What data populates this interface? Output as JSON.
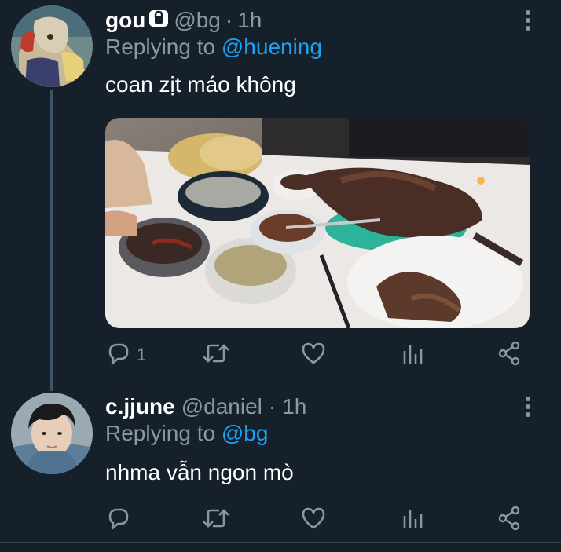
{
  "tweets": [
    {
      "display_name": "gou",
      "handle": "@bg",
      "separator": "·",
      "time": "1h",
      "replying_prefix": "Replying to",
      "replying_to": "@huening",
      "text": "coan zịt máo không",
      "protected": true,
      "reply_count": "1",
      "icons": [
        "reply-icon",
        "retweet-icon",
        "like-icon",
        "analytics-icon",
        "share-icon"
      ]
    },
    {
      "display_name": "c.jjune",
      "handle": "@daniel",
      "separator": "·",
      "time": "1h",
      "replying_prefix": "Replying to",
      "replying_to": "@bg",
      "text": "nhma vẫn ngon mò",
      "protected": false,
      "reply_count": "",
      "icons": [
        "reply-icon",
        "retweet-icon",
        "like-icon",
        "analytics-icon",
        "share-icon"
      ]
    }
  ],
  "colors": {
    "background": "#15202b",
    "text_primary": "#ffffff",
    "text_secondary": "#8899a6",
    "accent": "#1da1f2",
    "thread_line": "#3d5466"
  }
}
